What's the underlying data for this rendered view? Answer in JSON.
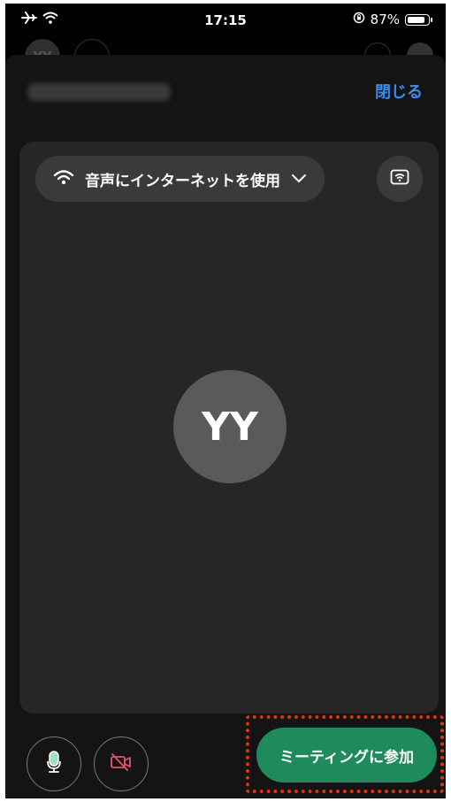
{
  "status_bar": {
    "time": "17:15",
    "battery_percent": "87%",
    "battery_level": 0.87,
    "icons": [
      "airplane-mode-icon",
      "wifi-icon",
      "orientation-lock-icon",
      "battery-icon"
    ]
  },
  "behind": {
    "avatar_initials": "YY"
  },
  "sheet": {
    "close_label": "閉じる",
    "audio_option_label": "音声にインターネットを使用",
    "avatar_initials": "YY",
    "join_label": "ミーティングに参加"
  },
  "colors": {
    "accent_link": "#3d8bf0",
    "join_button": "#1f8a5c",
    "mic_icon": "#9fe0c2",
    "camera_off_icon": "#e0566b",
    "highlight": "#e0330c"
  }
}
